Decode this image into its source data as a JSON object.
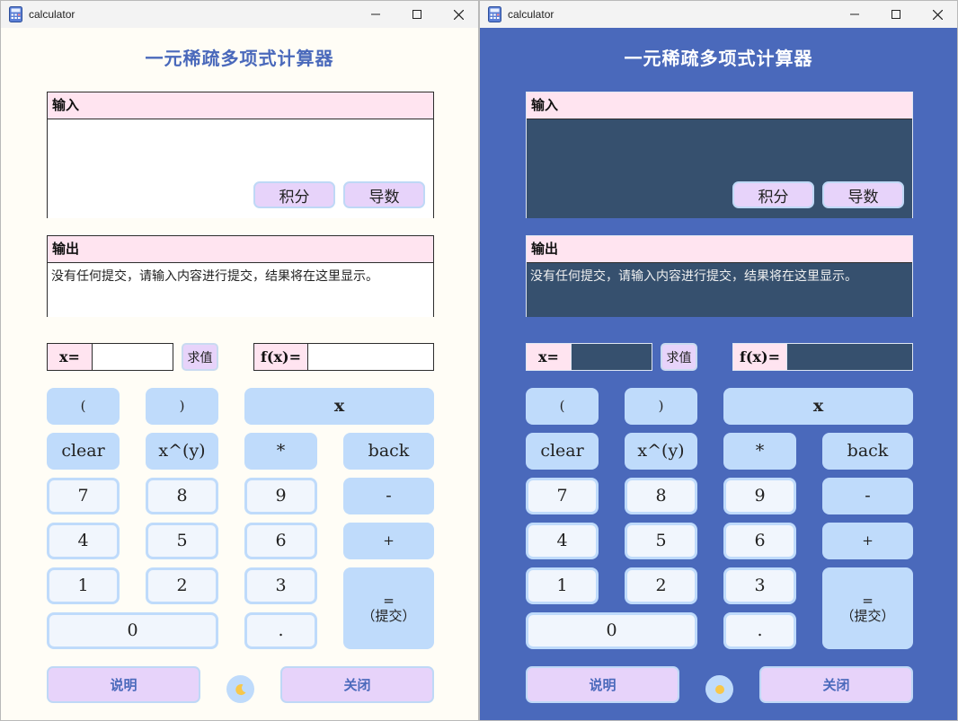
{
  "windows": [
    {
      "theme": "light",
      "window_title": "calculator",
      "heading": "一元稀疏多项式计算器",
      "input_label": "输入",
      "input_value": "",
      "integral_button": "积分",
      "derivative_button": "导数",
      "output_label": "输出",
      "output_text": "没有任何提交，请输入内容进行提交，结果将在这里显示。",
      "x_label": "x=",
      "eval_button": "求值",
      "fx_label": "f(x)=",
      "keys": {
        "lparen": "(",
        "rparen": ")",
        "x": "x",
        "clear": "clear",
        "pow": "x^(y)",
        "mul": "*",
        "back": "back",
        "k7": "7",
        "k8": "8",
        "k9": "9",
        "minus": "-",
        "k4": "4",
        "k5": "5",
        "k6": "6",
        "plus": "+",
        "k1": "1",
        "k2": "2",
        "k3": "3",
        "equals": "=",
        "submit": "（提交）",
        "k0": "0",
        "dot": "."
      },
      "help_button": "说明",
      "close_button": "关闭",
      "theme_icon": "moon-icon"
    },
    {
      "theme": "dark",
      "window_title": "calculator",
      "heading": "一元稀疏多项式计算器",
      "input_label": "输入",
      "input_value": "",
      "integral_button": "积分",
      "derivative_button": "导数",
      "output_label": "输出",
      "output_text": "没有任何提交，请输入内容进行提交，结果将在这里显示。",
      "x_label": "x=",
      "eval_button": "求值",
      "fx_label": "f(x)=",
      "keys": {
        "lparen": "(",
        "rparen": ")",
        "x": "x",
        "clear": "clear",
        "pow": "x^(y)",
        "mul": "*",
        "back": "back",
        "k7": "7",
        "k8": "8",
        "k9": "9",
        "minus": "-",
        "k4": "4",
        "k5": "5",
        "k6": "6",
        "plus": "+",
        "k1": "1",
        "k2": "2",
        "k3": "3",
        "equals": "=",
        "submit": "（提交）",
        "k0": "0",
        "dot": "."
      },
      "help_button": "说明",
      "close_button": "关闭",
      "theme_icon": "sun-icon"
    }
  ],
  "colors": {
    "accent": "#4a69bb",
    "key_blue": "#bfdbfb",
    "pill_lavender": "#e7d3fa",
    "label_pink": "#ffe4f0",
    "light_bg": "#fffdf6",
    "dark_field": "#36506e"
  }
}
